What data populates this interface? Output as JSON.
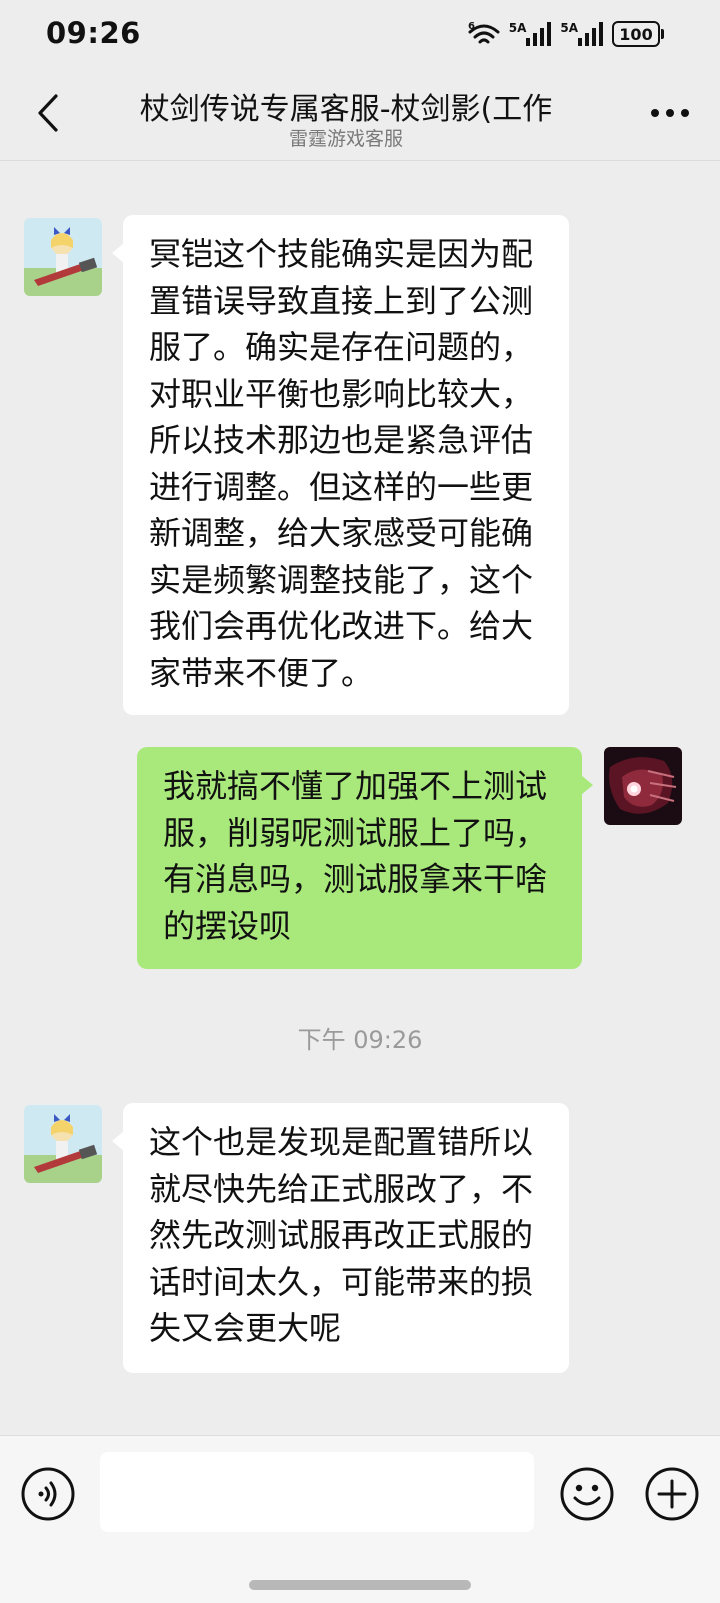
{
  "status_bar": {
    "time": "09:26",
    "wifi_badge": "6",
    "signal_1_label": "5A",
    "signal_2_label": "5A",
    "battery": "100"
  },
  "header": {
    "title": "杖剑传说专属客服-杖剑影(工作",
    "subtitle": "雷霆游戏客服"
  },
  "messages": [
    {
      "sender": "agent",
      "text": "冥铠这个技能确实是因为配置错误导致直接上到了公测服了。确实是存在问题的，对职业平衡也影响比较大，所以技术那边也是紧急评估进行调整。但这样的一些更新调整，给大家感受可能确实是频繁调整技能了，这个我们会再优化改进下。给大家带来不便了。"
    },
    {
      "sender": "me",
      "text": "我就搞不懂了加强不上测试服，削弱呢测试服上了吗，有消息吗，测试服拿来干啥的摆设呗"
    },
    {
      "sender": "agent",
      "text": "这个也是发现是配置错所以就尽快先给正式服改了，不然先改测试服再改正式服的话时间太久，可能带来的损失又会更大呢"
    }
  ],
  "timestamps": {
    "t1": "下午 09:26"
  },
  "input": {
    "value": "",
    "placeholder": ""
  },
  "icons": {
    "back": "chevron-left-icon",
    "more": "more-dots-icon",
    "voice": "voice-icon",
    "emoji": "emoji-icon",
    "plus": "plus-icon"
  },
  "colors": {
    "background": "#ededed",
    "incoming_bubble": "#ffffff",
    "outgoing_bubble": "#a9e97c",
    "timestamp": "#9a9a9a"
  }
}
